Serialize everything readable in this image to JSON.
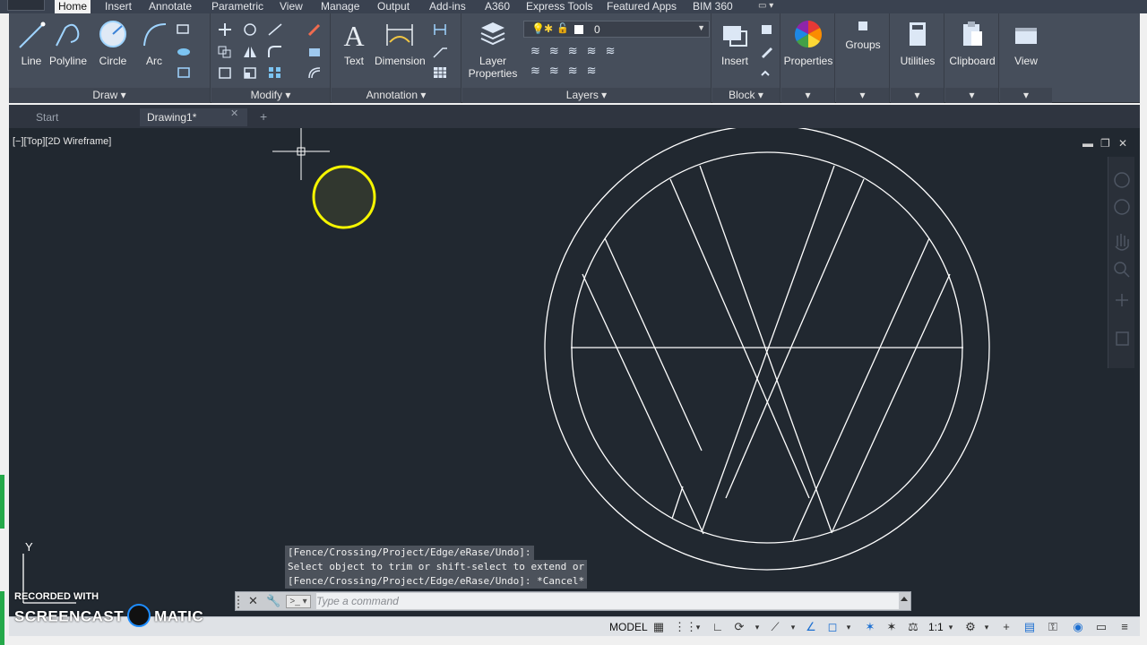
{
  "ribbon_tabs": [
    "Home",
    "Insert",
    "Annotate",
    "Parametric",
    "View",
    "Manage",
    "Output",
    "Add-ins",
    "A360",
    "Express Tools",
    "Featured Apps",
    "BIM 360"
  ],
  "active_tab": "Home",
  "panels": {
    "draw": {
      "label": "Draw",
      "tools": [
        "Line",
        "Polyline",
        "Circle",
        "Arc"
      ]
    },
    "modify": {
      "label": "Modify"
    },
    "annotation": {
      "label": "Annotation",
      "tools": [
        "Text",
        "Dimension"
      ]
    },
    "layers": {
      "label": "Layers",
      "tool": "Layer Properties",
      "tool_line1": "Layer",
      "tool_line2": "Properties",
      "current_layer": "0"
    },
    "block": {
      "label": "Block",
      "tool": "Insert"
    },
    "properties": {
      "label": "Properties"
    },
    "groups": {
      "label": "Groups"
    },
    "utilities": {
      "label": "Utilities"
    },
    "clipboard": {
      "label": "Clipboard"
    },
    "view": {
      "label": "View"
    }
  },
  "file_tabs": [
    "Start",
    "Drawing1*"
  ],
  "active_file_tab": "Drawing1*",
  "viewport_label": "[−][Top][2D Wireframe]",
  "command_history": [
    "[Fence/Crossing/Project/Edge/eRase/Undo]:",
    "Select object to trim or shift-select to extend or",
    "[Fence/Crossing/Project/Edge/eRase/Undo]: *Cancel*"
  ],
  "command_input": {
    "placeholder": "Type a command"
  },
  "status_bar": {
    "model_label": "MODEL",
    "scale": "1:1"
  },
  "ucs_axis_label": "Y",
  "watermark": {
    "line1": "RECORDED WITH",
    "brand": "SCREENCAST",
    "brand_suffix": "MATIC"
  },
  "colors": {
    "canvas_bg": "#212830",
    "drawing_lines": "#ffffff",
    "cursor_highlight": "#f5f500",
    "ribbon_bg": "#464e5b",
    "accent_blue": "#1c6fd1"
  }
}
